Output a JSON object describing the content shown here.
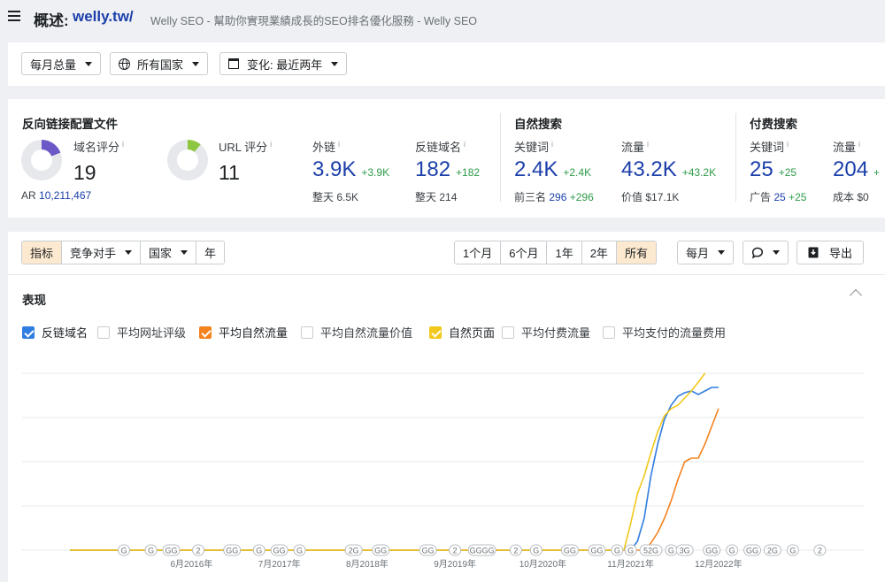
{
  "header": {
    "label": "概述:",
    "domain": "welly.tw/",
    "description": "Welly SEO - 幫助你實現業績成長的SEO排名優化服務 - Welly SEO"
  },
  "filters": {
    "volume": "每月总量",
    "country": "所有国家",
    "change": "变化: 最近两年"
  },
  "backlinks": {
    "title": "反向链接配置文件",
    "dr_label": "域名评分",
    "dr_value": "19",
    "dr_fill": 0.19,
    "ar_label": "AR",
    "ar_value": "10,211,467",
    "ur_label": "URL 评分",
    "ur_value": "11",
    "ur_fill": 0.11,
    "ext_label": "外链",
    "ext_value": "3.9K",
    "ext_delta": "+3.9K",
    "ext_sub_label": "整天",
    "ext_sub_value": "6.5K",
    "rd_label": "反链域名",
    "rd_value": "182",
    "rd_delta": "+182",
    "rd_sub_label": "整天",
    "rd_sub_value": "214",
    "info": "i"
  },
  "organic": {
    "title": "自然搜索",
    "kw_label": "关键词",
    "kw_value": "2.4K",
    "kw_delta": "+2.4K",
    "top3_label": "前三名",
    "top3_value": "296",
    "top3_delta": "+296",
    "traffic_label": "流量",
    "traffic_value": "43.2K",
    "traffic_delta": "+43.2K",
    "value_label": "价值",
    "value_value": "$17.1K"
  },
  "paid": {
    "title": "付费搜索",
    "kw_label": "关键词",
    "kw_value": "25",
    "kw_delta": "+25",
    "ads_label": "广告",
    "ads_value": "25",
    "ads_delta": "+25",
    "traffic_label": "流量",
    "traffic_value": "204",
    "traffic_delta": "+",
    "cost_label": "成本",
    "cost_value": "$0"
  },
  "toolbar": {
    "tabs": [
      "指标",
      "竞争对手",
      "国家",
      "年"
    ],
    "ranges": [
      "1个月",
      "6个月",
      "1年",
      "2年",
      "所有"
    ],
    "interval": "每月",
    "export": "导出"
  },
  "performance": {
    "title": "表现",
    "checkboxes": [
      {
        "label": "反链域名",
        "checked": true,
        "color": "#2f7de0"
      },
      {
        "label": "平均网址评级",
        "checked": false,
        "color": "#ffffff"
      },
      {
        "label": "平均自然流量",
        "checked": true,
        "color": "#f4821f"
      },
      {
        "label": "平均自然流量价值",
        "checked": false,
        "color": "#ffffff"
      },
      {
        "label": "自然页面",
        "checked": true,
        "color": "#f2c81b"
      },
      {
        "label": "平均付费流量",
        "checked": false,
        "color": "#ffffff"
      },
      {
        "label": "平均支付的流量费用",
        "checked": false,
        "color": "#ffffff"
      }
    ]
  },
  "colors": {
    "accent": "#1c3faa",
    "positive": "#2e9b49",
    "dr_donut": "#6d58c7",
    "ur_donut": "#8dc63f",
    "active_tab": "#fde9cf"
  },
  "chart_data": {
    "type": "line",
    "x_ticks": [
      "6月2016年",
      "7月2017年",
      "8月2018年",
      "9月2019年",
      "10月2020年",
      "11月2021年",
      "12月2022年"
    ],
    "x_tick_index": [
      18,
      31,
      44,
      57,
      70,
      83,
      96
    ],
    "series": [
      {
        "color": "#2f7de0",
        "values": [
          [
            0,
            0
          ],
          [
            83,
            0
          ],
          [
            84,
            0.05
          ],
          [
            85,
            0.18
          ],
          [
            86,
            0.42
          ],
          [
            87,
            0.6
          ],
          [
            88,
            0.74
          ],
          [
            89,
            0.82
          ],
          [
            90,
            0.87
          ],
          [
            91,
            0.89
          ],
          [
            92,
            0.9
          ],
          [
            93,
            0.88
          ],
          [
            94,
            0.9
          ],
          [
            95,
            0.92
          ],
          [
            96,
            0.92
          ]
        ]
      },
      {
        "color": "#f4821f",
        "values": [
          [
            0,
            0
          ],
          [
            85,
            0
          ],
          [
            86,
            0.04
          ],
          [
            87,
            0.1
          ],
          [
            88,
            0.18
          ],
          [
            89,
            0.28
          ],
          [
            90,
            0.4
          ],
          [
            91,
            0.5
          ],
          [
            92,
            0.52
          ],
          [
            93,
            0.52
          ],
          [
            94,
            0.6
          ],
          [
            95,
            0.7
          ],
          [
            96,
            0.8
          ]
        ]
      },
      {
        "color": "#f2c81b",
        "values": [
          [
            0,
            0
          ],
          [
            82,
            0
          ],
          [
            83,
            0.15
          ],
          [
            84,
            0.32
          ],
          [
            85,
            0.42
          ],
          [
            86,
            0.55
          ],
          [
            87,
            0.67
          ],
          [
            88,
            0.76
          ],
          [
            89,
            0.8
          ],
          [
            90,
            0.82
          ],
          [
            91,
            0.86
          ],
          [
            92,
            0.9
          ],
          [
            93,
            0.95
          ],
          [
            94,
            1.0
          ]
        ]
      }
    ],
    "annotations": [
      "G",
      "G",
      "GG",
      "2",
      "GG",
      "G",
      "GG",
      "G",
      "2G",
      "GG",
      "GG",
      "2",
      "GGGG",
      "2",
      "G",
      "GG",
      "GG",
      "G",
      "G",
      "52G",
      "G",
      "3G",
      "GG",
      "G",
      "GG",
      "2G",
      "G",
      "2"
    ],
    "annotation_index": [
      8,
      12,
      15,
      19,
      24,
      28,
      31,
      34,
      42,
      46,
      53,
      57,
      61,
      66,
      69,
      74,
      78,
      81,
      83,
      86,
      89,
      91,
      95,
      98,
      101,
      104,
      107,
      111
    ],
    "ylim": [
      0,
      1
    ],
    "grid": true
  }
}
